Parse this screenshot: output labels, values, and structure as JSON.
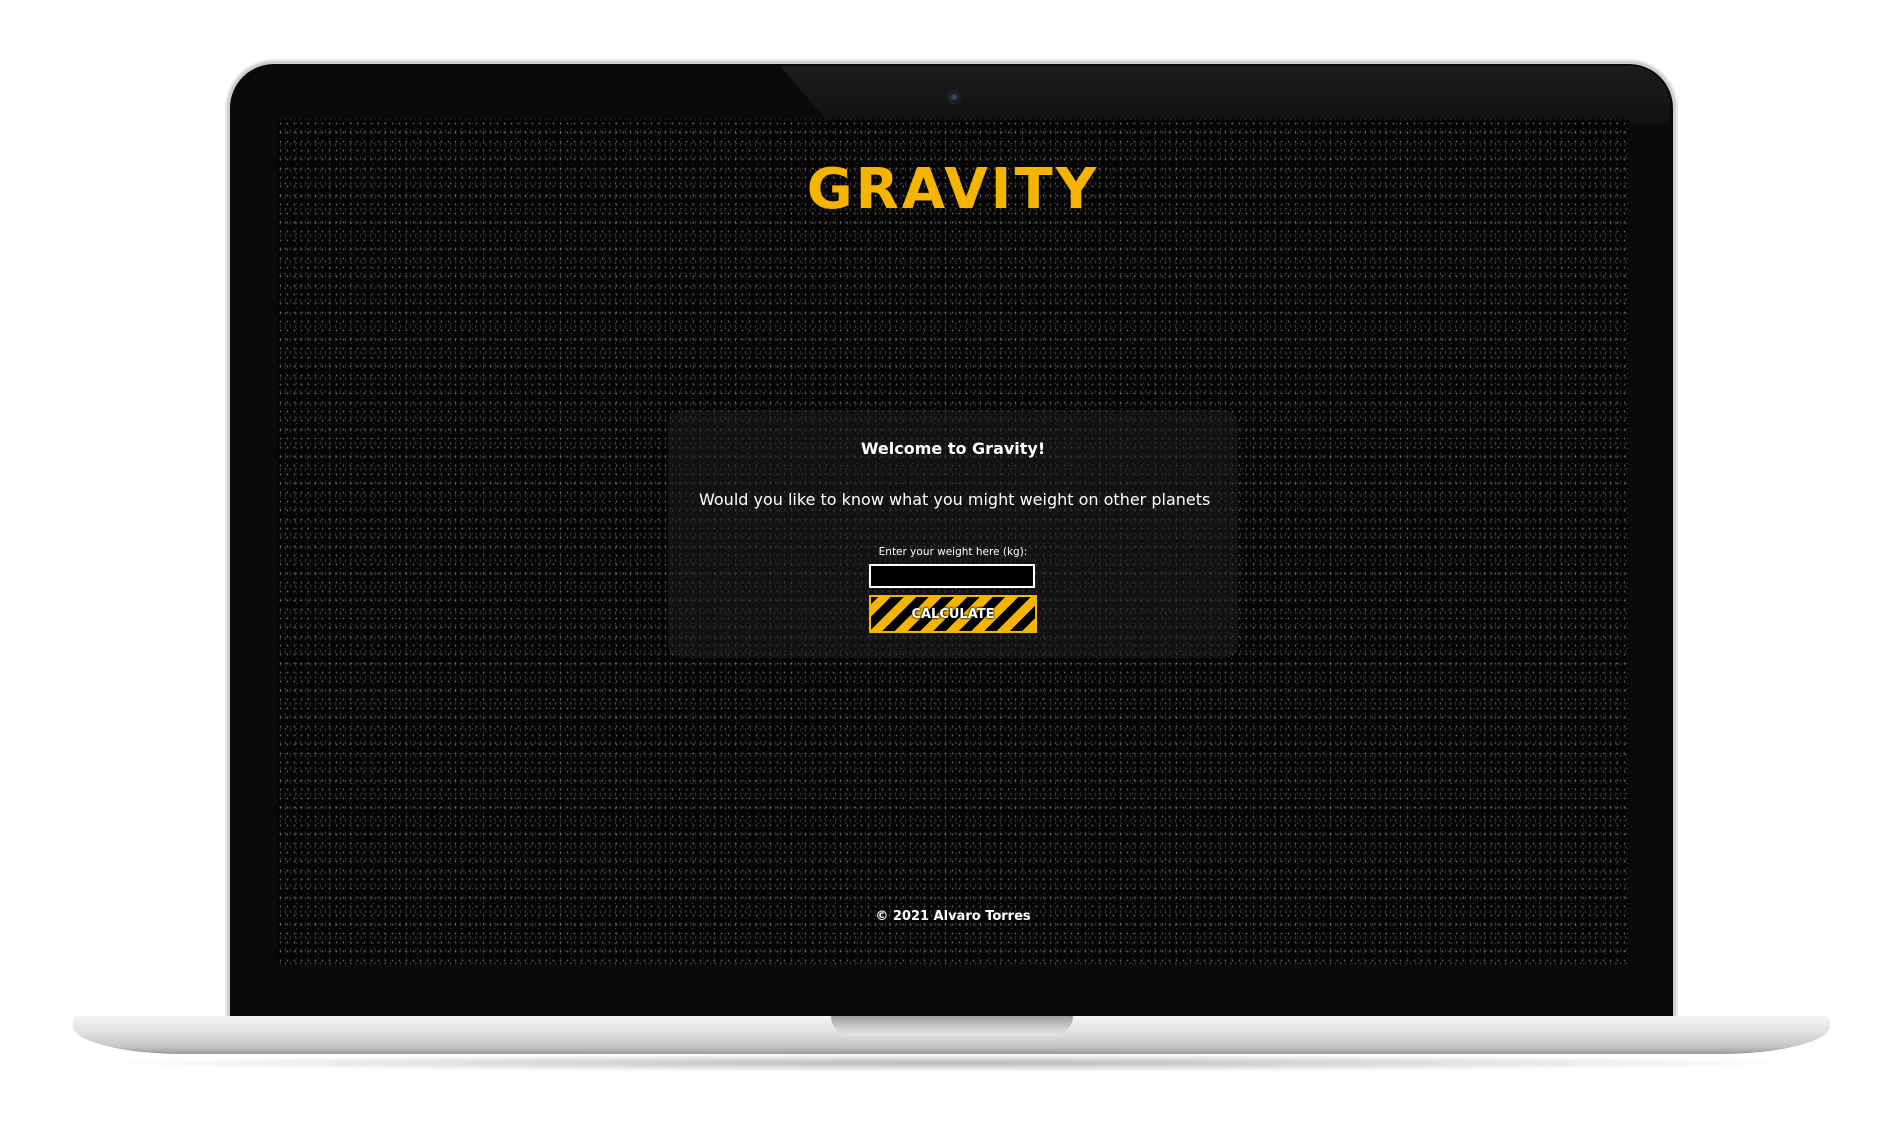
{
  "app": {
    "logo_text": "GRAVITY",
    "accent_color": "#f4b400"
  },
  "card": {
    "title": "Welcome to Gravity!",
    "question": "Would you like to know what you might weight on other planets",
    "input_label": "Enter your weight here (kg):",
    "input_value": "",
    "button_label": "CALCULATE"
  },
  "footer": {
    "copyright": "© 2021 Alvaro Torres"
  }
}
